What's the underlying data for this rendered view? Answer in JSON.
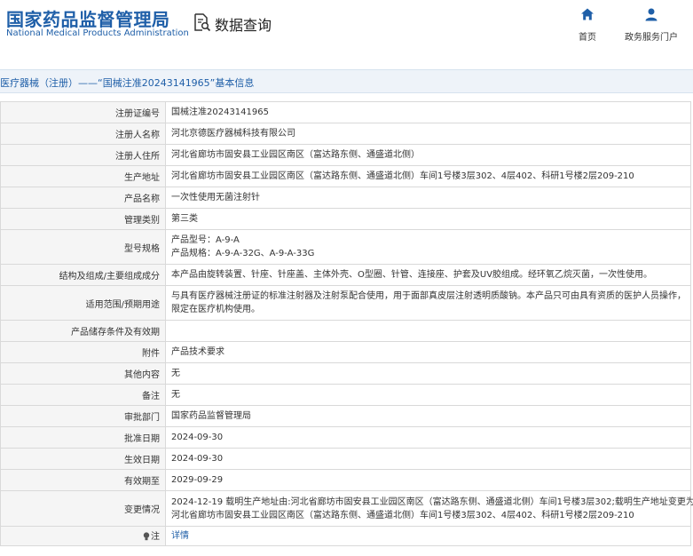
{
  "header": {
    "logo_cn": "国家药品监督管理局",
    "logo_en": "National Medical Products Administration",
    "data_query_label": "数据查询",
    "nav": [
      {
        "label": "首页",
        "icon": "home-icon"
      },
      {
        "label": "政务服务门户",
        "icon": "user-icon"
      }
    ]
  },
  "breadcrumb": {
    "text": "医疗器械（注册）——“国械注准20243141965”基本信息"
  },
  "rows": [
    {
      "label": "注册证编号",
      "lines": [
        "国械注准20243141965"
      ]
    },
    {
      "label": "注册人名称",
      "lines": [
        "河北京德医疗器械科技有限公司"
      ]
    },
    {
      "label": "注册人住所",
      "lines": [
        "河北省廊坊市固安县工业园区南区（富达路东侧、通盛道北侧）"
      ]
    },
    {
      "label": "生产地址",
      "lines": [
        "河北省廊坊市固安县工业园区南区（富达路东侧、通盛道北侧）车间1号楼3层302、4层402、科研1号楼2层209-210"
      ]
    },
    {
      "label": "产品名称",
      "lines": [
        "一次性使用无菌注射针"
      ]
    },
    {
      "label": "管理类别",
      "lines": [
        "第三类"
      ]
    },
    {
      "label": "型号规格",
      "lines": [
        "产品型号：A-9-A",
        "产品规格：A-9-A-32G、A-9-A-33G"
      ]
    },
    {
      "label": "结构及组成/主要组成成分",
      "lines": [
        "本产品由旋转装置、针座、针座盖、主体外壳、O型圈、针管、连接座、护套及UV胶组成。经环氧乙烷灭菌，一次性使用。"
      ]
    },
    {
      "label": "适用范围/预期用途",
      "lines": [
        "与具有医疗器械注册证的标准注射器及注射泵配合使用，用于面部真皮层注射透明质酸钠。本产品只可由具有资质的医护人员操作，",
        "限定在医疗机构使用。"
      ]
    },
    {
      "label": "产品储存条件及有效期",
      "lines": [
        ""
      ]
    },
    {
      "label": "附件",
      "lines": [
        "产品技术要求"
      ]
    },
    {
      "label": "其他内容",
      "lines": [
        "无"
      ]
    },
    {
      "label": "备注",
      "lines": [
        "无"
      ]
    },
    {
      "label": "审批部门",
      "lines": [
        "国家药品监督管理局"
      ]
    },
    {
      "label": "批准日期",
      "lines": [
        "2024-09-30"
      ]
    },
    {
      "label": "生效日期",
      "lines": [
        "2024-09-30"
      ]
    },
    {
      "label": "有效期至",
      "lines": [
        "2029-09-29"
      ]
    },
    {
      "label": "变更情况",
      "lines": [
        "2024-12-19 载明生产地址由:河北省廊坊市固安县工业园区南区（富达路东侧、通盛道北侧）车间1号楼3层302;载明生产地址变更为:",
        "河北省廊坊市固安县工业园区南区（富达路东侧、通盛道北侧）车间1号楼3层302、4层402、科研1号楼2层209-210"
      ]
    }
  ],
  "note": {
    "label": "注",
    "link": "详情"
  }
}
